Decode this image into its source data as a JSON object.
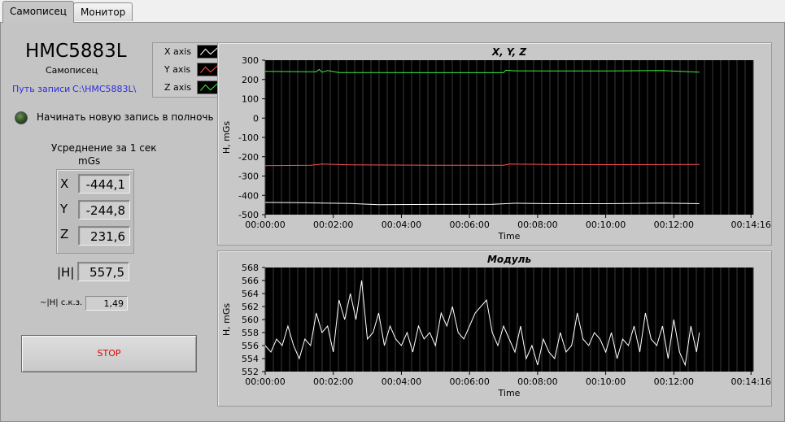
{
  "tabs": [
    {
      "label": "Самописец",
      "active": true
    },
    {
      "label": "Монитор",
      "active": false
    }
  ],
  "device": {
    "name": "HMC5883L",
    "subtitle": "Самописец",
    "path_label": "Путь записи",
    "path_value": "C:\\HMC5883L\\"
  },
  "midnight": {
    "label": "Начинать новую запись в полночь",
    "on": false
  },
  "averaging": {
    "title": "Усреднение за 1 сек",
    "unit": "mGs",
    "axes": [
      {
        "axis": "X",
        "value": "-444,1"
      },
      {
        "axis": "Y",
        "value": "-244,8"
      },
      {
        "axis": "Z",
        "value": "231,6"
      }
    ],
    "modulus": {
      "label": "|H|",
      "value": "557,5"
    },
    "rms": {
      "label": "~|H| с.к.з.",
      "value": "1,49"
    }
  },
  "stop_button": {
    "label": "STOP"
  },
  "legend": [
    {
      "name": "X axis",
      "color": "#ffffff"
    },
    {
      "name": "Y axis",
      "color": "#ff5050"
    },
    {
      "name": "Z axis",
      "color": "#3cf03c"
    }
  ],
  "colors": {
    "plot_bg": "#000000",
    "grid": "#3a3a3a",
    "stop_text": "#e00000",
    "path_text": "#2d2de0"
  },
  "chart_data": [
    {
      "type": "line",
      "title": "X, Y, Z",
      "xlabel": "Time",
      "ylabel": "H, mGs",
      "xlim": [
        0,
        860
      ],
      "ylim": [
        -500,
        300
      ],
      "yticks": [
        "300",
        "200",
        "100",
        "0",
        "-100",
        "-200",
        "-300",
        "-400",
        "-500"
      ],
      "xticks": [
        "00:00:00",
        "00:02:00",
        "00:04:00",
        "00:06:00",
        "00:08:00",
        "00:10:00",
        "00:12:00",
        "00:14:16"
      ],
      "xtick_values": [
        0,
        120,
        240,
        360,
        480,
        600,
        720,
        856
      ],
      "grid": "vertical",
      "series": [
        {
          "name": "X axis",
          "color": "#ffffff",
          "x": [
            0,
            60,
            100,
            150,
            200,
            300,
            400,
            440,
            500,
            600,
            700,
            765
          ],
          "y": [
            -437,
            -438,
            -440,
            -442,
            -448,
            -447,
            -446,
            -441,
            -443,
            -443,
            -440,
            -443
          ]
        },
        {
          "name": "Y axis",
          "color": "#ff5050",
          "x": [
            0,
            80,
            100,
            150,
            300,
            420,
            430,
            500,
            600,
            765
          ],
          "y": [
            -246,
            -244,
            -238,
            -242,
            -244,
            -244,
            -238,
            -240,
            -241,
            -240
          ]
        },
        {
          "name": "Z axis",
          "color": "#3cf03c",
          "x": [
            0,
            90,
            95,
            100,
            110,
            130,
            200,
            300,
            420,
            424,
            440,
            500,
            600,
            700,
            765
          ],
          "y": [
            242,
            240,
            252,
            238,
            246,
            236,
            236,
            235,
            235,
            248,
            245,
            244,
            244,
            246,
            238
          ]
        }
      ]
    },
    {
      "type": "line",
      "title": "Модуль",
      "xlabel": "Time",
      "ylabel": "H, mGs",
      "xlim": [
        0,
        860
      ],
      "ylim": [
        552,
        568
      ],
      "yticks": [
        "568",
        "566",
        "564",
        "562",
        "560",
        "558",
        "556",
        "554",
        "552"
      ],
      "xticks": [
        "00:00:00",
        "00:02:00",
        "00:04:00",
        "00:06:00",
        "00:08:00",
        "00:10:00",
        "00:12:00",
        "00:14:16"
      ],
      "xtick_values": [
        0,
        120,
        240,
        360,
        480,
        600,
        720,
        856
      ],
      "grid": "vertical",
      "series": [
        {
          "name": "Модуль",
          "color": "#ffffff",
          "x": [
            0,
            10,
            20,
            30,
            40,
            50,
            60,
            70,
            80,
            90,
            100,
            110,
            120,
            130,
            140,
            150,
            160,
            170,
            180,
            190,
            200,
            210,
            220,
            230,
            240,
            250,
            260,
            270,
            280,
            290,
            300,
            310,
            320,
            330,
            340,
            350,
            360,
            370,
            380,
            390,
            400,
            410,
            420,
            430,
            440,
            450,
            460,
            470,
            480,
            490,
            500,
            510,
            520,
            530,
            540,
            550,
            560,
            570,
            580,
            590,
            600,
            610,
            620,
            630,
            640,
            650,
            660,
            670,
            680,
            690,
            700,
            710,
            720,
            730,
            740,
            750,
            760,
            765
          ],
          "y": [
            556,
            555,
            557,
            556,
            559,
            556,
            554,
            557,
            556,
            561,
            558,
            559,
            555,
            563,
            560,
            564,
            560,
            566,
            557,
            558,
            561,
            556,
            559,
            557,
            556,
            558,
            555,
            559,
            557,
            558,
            556,
            561,
            559,
            562,
            558,
            557,
            559,
            561,
            562,
            563,
            558,
            556,
            559,
            557,
            555,
            559,
            554,
            556,
            553,
            557,
            555,
            554,
            558,
            555,
            556,
            561,
            557,
            556,
            558,
            557,
            555,
            558,
            554,
            557,
            556,
            559,
            555,
            561,
            557,
            556,
            559,
            554,
            560,
            555,
            553,
            559,
            555,
            558
          ]
        }
      ]
    }
  ]
}
